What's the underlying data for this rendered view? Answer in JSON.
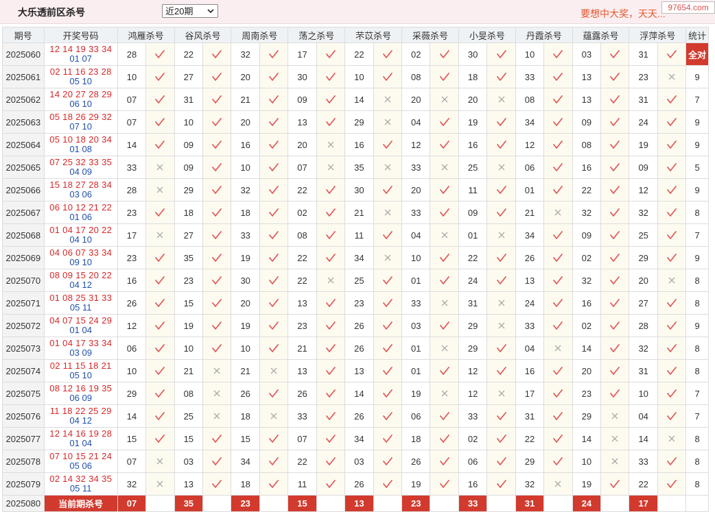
{
  "header": {
    "title": "大乐透前区杀号",
    "range_value": "近20期",
    "ticker": "要想中大奖，天天...",
    "site": "97654.com"
  },
  "table": {
    "columns": [
      "期号",
      "开奖号码",
      "鸿雁杀号",
      "谷风杀号",
      "周南杀号",
      "荡之杀号",
      "芣苡杀号",
      "采薇杀号",
      "小旻杀号",
      "丹霞杀号",
      "蕴露杀号",
      "浮萍杀号",
      "统计"
    ],
    "rows": [
      {
        "issue": "2025060",
        "front": "12 14 19 33 34",
        "back": "01 07",
        "kills": [
          [
            "28",
            1
          ],
          [
            "22",
            1
          ],
          [
            "32",
            1
          ],
          [
            "17",
            1
          ],
          [
            "22",
            1
          ],
          [
            "02",
            1
          ],
          [
            "30",
            1
          ],
          [
            "10",
            1
          ],
          [
            "03",
            1
          ],
          [
            "31",
            1
          ]
        ],
        "stat": "全对"
      },
      {
        "issue": "2025061",
        "front": "02 11 16 23 28",
        "back": "05 10",
        "kills": [
          [
            "10",
            1
          ],
          [
            "27",
            1
          ],
          [
            "20",
            1
          ],
          [
            "30",
            1
          ],
          [
            "10",
            1
          ],
          [
            "08",
            1
          ],
          [
            "18",
            1
          ],
          [
            "33",
            1
          ],
          [
            "13",
            1
          ],
          [
            "23",
            0
          ]
        ],
        "stat": "9"
      },
      {
        "issue": "2025062",
        "front": "14 20 27 28 29",
        "back": "06 10",
        "kills": [
          [
            "07",
            1
          ],
          [
            "31",
            1
          ],
          [
            "21",
            1
          ],
          [
            "09",
            1
          ],
          [
            "14",
            0
          ],
          [
            "20",
            0
          ],
          [
            "20",
            0
          ],
          [
            "08",
            1
          ],
          [
            "13",
            1
          ],
          [
            "31",
            1
          ]
        ],
        "stat": "7"
      },
      {
        "issue": "2025063",
        "front": "05 18 26 29 32",
        "back": "07 10",
        "kills": [
          [
            "07",
            1
          ],
          [
            "10",
            1
          ],
          [
            "20",
            1
          ],
          [
            "13",
            1
          ],
          [
            "29",
            0
          ],
          [
            "04",
            1
          ],
          [
            "19",
            1
          ],
          [
            "34",
            1
          ],
          [
            "09",
            1
          ],
          [
            "24",
            1
          ]
        ],
        "stat": "9"
      },
      {
        "issue": "2025064",
        "front": "05 10 18 20 34",
        "back": "01 08",
        "kills": [
          [
            "14",
            1
          ],
          [
            "09",
            1
          ],
          [
            "16",
            1
          ],
          [
            "20",
            0
          ],
          [
            "16",
            1
          ],
          [
            "12",
            1
          ],
          [
            "16",
            1
          ],
          [
            "12",
            1
          ],
          [
            "08",
            1
          ],
          [
            "19",
            1
          ]
        ],
        "stat": "9"
      },
      {
        "issue": "2025065",
        "front": "07 25 32 33 35",
        "back": "04 09",
        "kills": [
          [
            "33",
            0
          ],
          [
            "09",
            1
          ],
          [
            "10",
            1
          ],
          [
            "07",
            0
          ],
          [
            "35",
            0
          ],
          [
            "33",
            0
          ],
          [
            "25",
            0
          ],
          [
            "06",
            1
          ],
          [
            "16",
            1
          ],
          [
            "09",
            1
          ]
        ],
        "stat": "5"
      },
      {
        "issue": "2025066",
        "front": "15 18 27 28 34",
        "back": "03 06",
        "kills": [
          [
            "28",
            0
          ],
          [
            "29",
            1
          ],
          [
            "32",
            1
          ],
          [
            "22",
            1
          ],
          [
            "30",
            1
          ],
          [
            "20",
            1
          ],
          [
            "11",
            1
          ],
          [
            "01",
            1
          ],
          [
            "22",
            1
          ],
          [
            "12",
            1
          ]
        ],
        "stat": "9"
      },
      {
        "issue": "2025067",
        "front": "06 10 12 21 22",
        "back": "01 06",
        "kills": [
          [
            "23",
            1
          ],
          [
            "18",
            1
          ],
          [
            "18",
            1
          ],
          [
            "02",
            1
          ],
          [
            "21",
            0
          ],
          [
            "33",
            1
          ],
          [
            "09",
            1
          ],
          [
            "21",
            0
          ],
          [
            "32",
            1
          ],
          [
            "32",
            1
          ]
        ],
        "stat": "8"
      },
      {
        "issue": "2025068",
        "front": "01 04 17 20 22",
        "back": "04 10",
        "kills": [
          [
            "17",
            0
          ],
          [
            "27",
            1
          ],
          [
            "33",
            1
          ],
          [
            "08",
            1
          ],
          [
            "11",
            1
          ],
          [
            "04",
            0
          ],
          [
            "01",
            0
          ],
          [
            "34",
            1
          ],
          [
            "09",
            1
          ],
          [
            "25",
            1
          ]
        ],
        "stat": "7"
      },
      {
        "issue": "2025069",
        "front": "04 06 07 33 34",
        "back": "09 10",
        "kills": [
          [
            "23",
            1
          ],
          [
            "35",
            1
          ],
          [
            "19",
            1
          ],
          [
            "22",
            1
          ],
          [
            "34",
            0
          ],
          [
            "10",
            1
          ],
          [
            "22",
            1
          ],
          [
            "26",
            1
          ],
          [
            "02",
            1
          ],
          [
            "29",
            1
          ]
        ],
        "stat": "9"
      },
      {
        "issue": "2025070",
        "front": "08 09 15 20 22",
        "back": "04 12",
        "kills": [
          [
            "16",
            1
          ],
          [
            "23",
            1
          ],
          [
            "30",
            1
          ],
          [
            "22",
            0
          ],
          [
            "25",
            1
          ],
          [
            "01",
            1
          ],
          [
            "24",
            1
          ],
          [
            "13",
            1
          ],
          [
            "32",
            1
          ],
          [
            "20",
            0
          ]
        ],
        "stat": "8"
      },
      {
        "issue": "2025071",
        "front": "01 08 25 31 33",
        "back": "05 11",
        "kills": [
          [
            "26",
            1
          ],
          [
            "15",
            1
          ],
          [
            "20",
            1
          ],
          [
            "13",
            1
          ],
          [
            "23",
            1
          ],
          [
            "33",
            0
          ],
          [
            "31",
            0
          ],
          [
            "24",
            1
          ],
          [
            "16",
            1
          ],
          [
            "27",
            1
          ]
        ],
        "stat": "8"
      },
      {
        "issue": "2025072",
        "front": "04 07 15 24 29",
        "back": "01 04",
        "kills": [
          [
            "12",
            1
          ],
          [
            "19",
            1
          ],
          [
            "19",
            1
          ],
          [
            "23",
            1
          ],
          [
            "26",
            1
          ],
          [
            "03",
            1
          ],
          [
            "29",
            0
          ],
          [
            "33",
            1
          ],
          [
            "02",
            1
          ],
          [
            "28",
            1
          ]
        ],
        "stat": "9"
      },
      {
        "issue": "2025073",
        "front": "01 04 17 33 34",
        "back": "03 09",
        "kills": [
          [
            "06",
            1
          ],
          [
            "10",
            1
          ],
          [
            "10",
            1
          ],
          [
            "21",
            1
          ],
          [
            "26",
            1
          ],
          [
            "01",
            0
          ],
          [
            "29",
            1
          ],
          [
            "04",
            0
          ],
          [
            "14",
            1
          ],
          [
            "32",
            1
          ]
        ],
        "stat": "8"
      },
      {
        "issue": "2025074",
        "front": "02 11 15 18 21",
        "back": "05 10",
        "kills": [
          [
            "10",
            1
          ],
          [
            "21",
            0
          ],
          [
            "21",
            0
          ],
          [
            "13",
            1
          ],
          [
            "13",
            1
          ],
          [
            "01",
            1
          ],
          [
            "12",
            1
          ],
          [
            "16",
            1
          ],
          [
            "20",
            1
          ],
          [
            "31",
            1
          ]
        ],
        "stat": "8"
      },
      {
        "issue": "2025075",
        "front": "08 12 16 19 35",
        "back": "06 09",
        "kills": [
          [
            "29",
            1
          ],
          [
            "08",
            0
          ],
          [
            "26",
            1
          ],
          [
            "26",
            1
          ],
          [
            "14",
            1
          ],
          [
            "19",
            0
          ],
          [
            "12",
            0
          ],
          [
            "17",
            1
          ],
          [
            "23",
            1
          ],
          [
            "10",
            1
          ]
        ],
        "stat": "7"
      },
      {
        "issue": "2025076",
        "front": "11 18 22 25 29",
        "back": "04 12",
        "kills": [
          [
            "14",
            1
          ],
          [
            "25",
            0
          ],
          [
            "18",
            0
          ],
          [
            "33",
            1
          ],
          [
            "26",
            1
          ],
          [
            "06",
            1
          ],
          [
            "33",
            1
          ],
          [
            "31",
            1
          ],
          [
            "29",
            0
          ],
          [
            "04",
            1
          ]
        ],
        "stat": "7"
      },
      {
        "issue": "2025077",
        "front": "12 14 16 19 28",
        "back": "01 04",
        "kills": [
          [
            "15",
            1
          ],
          [
            "15",
            1
          ],
          [
            "15",
            1
          ],
          [
            "07",
            1
          ],
          [
            "34",
            1
          ],
          [
            "18",
            1
          ],
          [
            "02",
            1
          ],
          [
            "22",
            1
          ],
          [
            "14",
            0
          ],
          [
            "14",
            0
          ]
        ],
        "stat": "8"
      },
      {
        "issue": "2025078",
        "front": "07 10 15 21 24",
        "back": "05 06",
        "kills": [
          [
            "07",
            0
          ],
          [
            "03",
            1
          ],
          [
            "34",
            1
          ],
          [
            "22",
            1
          ],
          [
            "03",
            1
          ],
          [
            "26",
            1
          ],
          [
            "06",
            1
          ],
          [
            "29",
            1
          ],
          [
            "10",
            0
          ],
          [
            "33",
            1
          ]
        ],
        "stat": "8"
      },
      {
        "issue": "2025079",
        "front": "02 14 32 34 35",
        "back": "05 11",
        "kills": [
          [
            "32",
            0
          ],
          [
            "13",
            1
          ],
          [
            "18",
            1
          ],
          [
            "11",
            1
          ],
          [
            "26",
            1
          ],
          [
            "19",
            1
          ],
          [
            "16",
            1
          ],
          [
            "32",
            0
          ],
          [
            "19",
            1
          ],
          [
            "22",
            1
          ]
        ],
        "stat": "8"
      }
    ],
    "current": {
      "issue": "2025080",
      "label": "当前期杀号",
      "values": [
        "07",
        "35",
        "23",
        "15",
        "13",
        "23",
        "33",
        "31",
        "24",
        "17"
      ]
    }
  },
  "colors": {
    "accent": "#d23a2e",
    "front": "#d62728",
    "back": "#1f4fa8",
    "check": "#e05a5a",
    "cross": "#aaaaaa"
  }
}
